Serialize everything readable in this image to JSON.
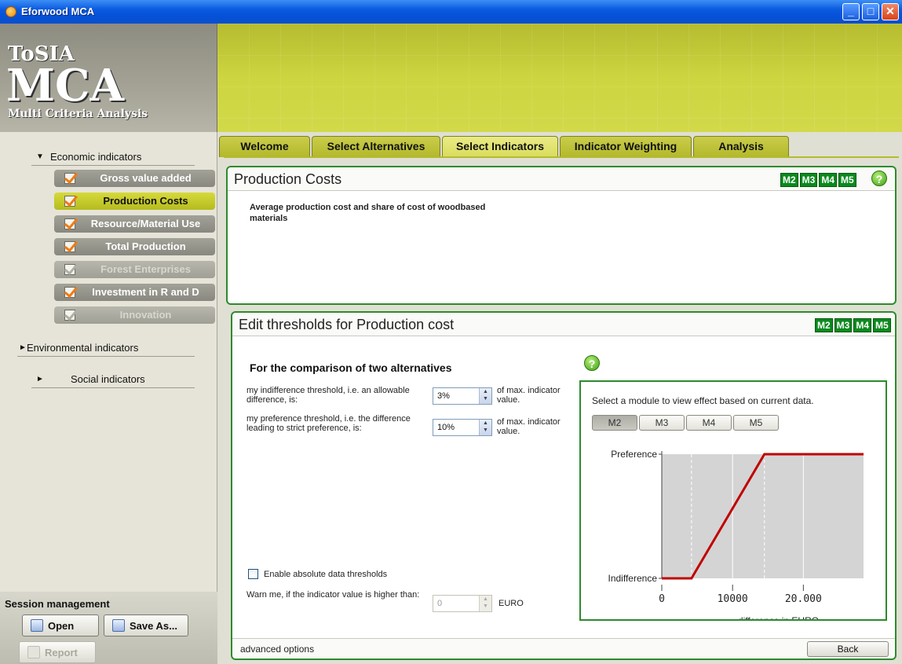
{
  "window": {
    "title": "Eforwood MCA",
    "buttons": {
      "minimize": "_",
      "maximize": "□",
      "close": "✕"
    }
  },
  "logo": {
    "line1": "ToSIA",
    "line2": "MCA",
    "line3": "Multi Criteria Analysis"
  },
  "sidebar": {
    "groups": [
      {
        "label": "Economic indicators",
        "expanded": true
      },
      {
        "label": "Environmental indicators",
        "expanded": false
      },
      {
        "label": "Social indicators",
        "expanded": false
      }
    ],
    "economic_items": [
      {
        "label": "Gross value added",
        "state": "normal"
      },
      {
        "label": "Production Costs",
        "state": "active"
      },
      {
        "label": "Resource/Material Use",
        "state": "normal"
      },
      {
        "label": "Total Production",
        "state": "normal"
      },
      {
        "label": "Forest Enterprises",
        "state": "disabled"
      },
      {
        "label": "Investment in R and D",
        "state": "normal"
      },
      {
        "label": "Innovation",
        "state": "disabled"
      }
    ],
    "arrows": {
      "expanded": "▼",
      "collapsed": "►"
    }
  },
  "session": {
    "title": "Session management",
    "open": "Open",
    "save_as": "Save As...",
    "report": "Report"
  },
  "tabs": [
    {
      "label": "Welcome",
      "active": false
    },
    {
      "label": "Select Alternatives",
      "active": false
    },
    {
      "label": "Select Indicators",
      "active": true
    },
    {
      "label": "Indicator Weighting",
      "active": false
    },
    {
      "label": "Analysis",
      "active": false
    }
  ],
  "modules": [
    "M2",
    "M3",
    "M4",
    "M5"
  ],
  "indicator_panel": {
    "title": "Production Costs",
    "description": "Average production cost and share of cost of woodbased materials"
  },
  "threshold_panel": {
    "title": "Edit thresholds for Production cost",
    "subtitle": "For the comparison of two alternatives",
    "indifference_label": "my indifference threshold, i.e. an allowable difference, is:",
    "indifference_value": "3%",
    "preference_label": "my preference threshold, i.e. the difference leading to strict preference, is:",
    "preference_value": "10%",
    "unit_label": "of max. indicator value.",
    "absolute_checkbox": "Enable absolute data thresholds",
    "absolute_checked": false,
    "warn_label": "Warn me, if the indicator value is higher than:",
    "warn_value": "0",
    "warn_unit": "EURO",
    "advanced": "advanced options",
    "back": "Back",
    "graph_hint": "Select a module to view effect based on current data.",
    "module_tabs": [
      "M2",
      "M3",
      "M4",
      "M5"
    ],
    "active_module": "M2"
  },
  "help_glyph": "?",
  "chart_data": {
    "type": "line",
    "xlabel": "difference in EURO",
    "ylabel": "",
    "y_categories": [
      "Indifference",
      "Preference"
    ],
    "x_ticks": [
      {
        "value": 0,
        "label": "0"
      },
      {
        "value": 10000,
        "label": "10000"
      },
      {
        "value": 20000,
        "label": "20.000"
      }
    ],
    "xlim": [
      0,
      28500
    ],
    "ylim": [
      0,
      1
    ],
    "series": [
      {
        "points": [
          [
            0,
            0
          ],
          [
            4200,
            0
          ],
          [
            14500,
            1
          ],
          [
            28500,
            1
          ]
        ],
        "color": "#c00000"
      }
    ],
    "indifference_threshold_x": 4200,
    "preference_threshold_x": 14500,
    "grid": true,
    "plot_background": "#d4d4d4"
  }
}
